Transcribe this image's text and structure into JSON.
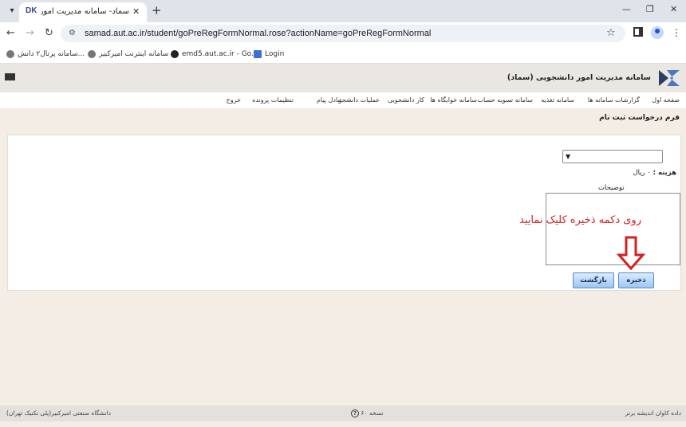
{
  "browser": {
    "tab_title": "سماد- سامانه مدیریت امور دانش",
    "tab_favicon": "DK",
    "url": "samad.aut.ac.ir/student/goPreRegFormNormal.rose?actionName=goPreRegFormNormal",
    "bookmarks": [
      "سامانه پرتال۲ دانش...",
      "سامانه اینترنت امیرکبیر",
      "emd5.aut.ac.ir - Go...",
      "Login"
    ]
  },
  "app": {
    "title": "سامانه مدیریت امور دانشجویی (سماد)",
    "menu": [
      "صفحه اول",
      "گزارشات سامانه ها",
      "سامانه تغذیه",
      "سامانه تسویه حساب",
      "سامانه خوابگاه ها",
      "کار دانشجویی",
      "عملیات دانشجو",
      "تبادل پیام",
      "تنظیمات پرونده",
      "خروج"
    ]
  },
  "form": {
    "title": "فرم درخواست ثبت نام",
    "fee_label": "هزینه :",
    "fee_value": "۰ ریال",
    "description_label": "توضیحات",
    "annotation": "روی دکمه ذخیره کلیک نمایید",
    "save_button": "ذخیره",
    "back_button": "بازگشت"
  },
  "footer": {
    "right": "داده کاوان اندیشه برتر",
    "center": "نسخه ۶۰",
    "left": "دانشگاه صنعتی امیرکبیر(پلی تکنیک تهران)"
  },
  "colors": {
    "annotation": "#d42020",
    "page_bg": "#f3ede6"
  }
}
